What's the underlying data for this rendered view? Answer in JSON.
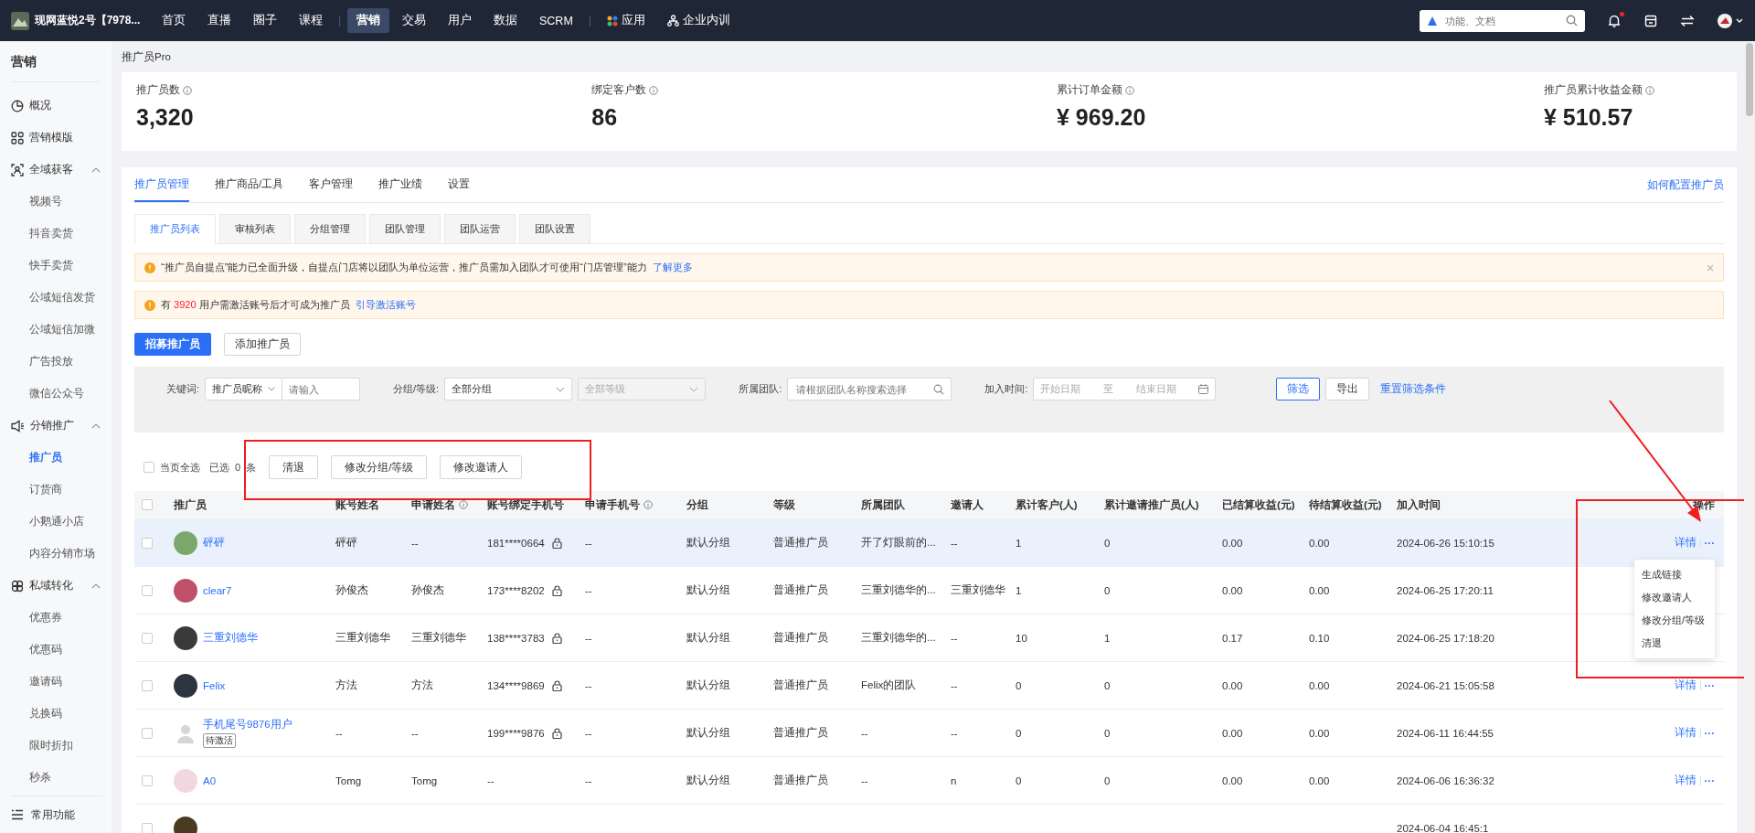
{
  "topnav": {
    "brand": "现网蓝悦2号【7978...",
    "items": [
      {
        "label": "首页",
        "selected": false,
        "kind": "text"
      },
      {
        "label": "直播",
        "selected": false,
        "kind": "text"
      },
      {
        "label": "圈子",
        "selected": false,
        "kind": "text"
      },
      {
        "label": "课程",
        "selected": false,
        "kind": "text"
      },
      {
        "label": "营销",
        "selected": true,
        "kind": "text"
      },
      {
        "label": "交易",
        "selected": false,
        "kind": "text"
      },
      {
        "label": "用户",
        "selected": false,
        "kind": "text"
      },
      {
        "label": "数据",
        "selected": false,
        "kind": "text"
      },
      {
        "label": "SCRM",
        "selected": false,
        "kind": "text"
      },
      {
        "label": "应用",
        "selected": false,
        "kind": "apps"
      },
      {
        "label": "企业内训",
        "selected": false,
        "kind": "org"
      }
    ],
    "search": {
      "placeholder": "功能、文档"
    },
    "notification_dot": true
  },
  "sidebar": {
    "title": "营销",
    "groups": [
      {
        "label": "概况",
        "kind": "pie",
        "expanded": false
      },
      {
        "label": "营销模版",
        "kind": "grid",
        "expanded": false
      },
      {
        "label": "全域获客",
        "kind": "scan",
        "expanded": true,
        "children": [
          {
            "label": "视频号",
            "selected": false
          },
          {
            "label": "抖音卖货",
            "selected": false
          },
          {
            "label": "快手卖货",
            "selected": false
          },
          {
            "label": "公域短信发货",
            "selected": false
          },
          {
            "label": "公域短信加微",
            "selected": false
          },
          {
            "label": "广告投放",
            "selected": false
          },
          {
            "label": "微信公众号",
            "selected": false
          }
        ]
      },
      {
        "label": "分销推广",
        "kind": "speaker",
        "expanded": true,
        "children": [
          {
            "label": "推广员",
            "selected": true
          },
          {
            "label": "订货商",
            "selected": false
          },
          {
            "label": "小鹅通小店",
            "selected": false
          },
          {
            "label": "内容分销市场",
            "selected": false
          }
        ]
      },
      {
        "label": "私域转化",
        "kind": "flower",
        "expanded": true,
        "children": [
          {
            "label": "优惠券",
            "selected": false
          },
          {
            "label": "优惠码",
            "selected": false
          },
          {
            "label": "邀请码",
            "selected": false
          },
          {
            "label": "兑换码",
            "selected": false
          },
          {
            "label": "限时折扣",
            "selected": false
          },
          {
            "label": "秒杀",
            "selected": false
          }
        ]
      }
    ],
    "footer": "常用功能"
  },
  "breadcrumb": "推广员Pro",
  "stats": [
    {
      "label": "推广员数",
      "value": "3,320"
    },
    {
      "label": "绑定客户数",
      "value": "86"
    },
    {
      "label": "累计订单金额",
      "value": "¥ 969.20"
    },
    {
      "label": "推广员累计收益金额",
      "value": "¥ 510.57"
    }
  ],
  "tabs": [
    {
      "label": "推广员管理",
      "selected": true
    },
    {
      "label": "推广商品/工具",
      "selected": false
    },
    {
      "label": "客户管理",
      "selected": false
    },
    {
      "label": "推广业绩",
      "selected": false
    },
    {
      "label": "设置",
      "selected": false
    }
  ],
  "help_link": "如何配置推广员",
  "subtabs": [
    {
      "label": "推广员列表",
      "selected": true
    },
    {
      "label": "审核列表",
      "selected": false
    },
    {
      "label": "分组管理",
      "selected": false
    },
    {
      "label": "团队管理",
      "selected": false
    },
    {
      "label": "团队运营",
      "selected": false
    },
    {
      "label": "团队设置",
      "selected": false
    }
  ],
  "alerts": [
    {
      "text": "“推广员自提点”能力已全面升级，自提点门店将以团队为单位运营，推广员需加入团队才可使用“门店管理”能力",
      "link": "了解更多",
      "closable": true
    },
    {
      "text": "有",
      "count": "3920",
      "suffix": "用户需激活账号后才可成为推广员",
      "link": "引导激活账号"
    }
  ],
  "actions": [
    {
      "label": "招募推广员",
      "kind": "primary"
    },
    {
      "label": "添加推广员",
      "kind": "default"
    }
  ],
  "filters": {
    "keyword_label": "关键词:",
    "keyword_type": "推广员昵称",
    "keyword_placeholder": "请输入",
    "group_label": "分组/等级:",
    "group_value": "全部分组",
    "level_value": "全部等级",
    "level_disabled": true,
    "team_label": "所属团队:",
    "team_placeholder": "请根据团队名称搜索选择",
    "time_label": "加入时间:",
    "start_placeholder": "开始日期",
    "range_sep": "至",
    "end_placeholder": "结束日期",
    "filter_button": "筛选",
    "export_button": "导出",
    "reset_link": "重置筛选条件"
  },
  "batch": {
    "select_all": "当页全选",
    "select_all_checked": false,
    "selected_label": "已选",
    "selected_count": "0",
    "unit": "条",
    "buttons": [
      "清退",
      "修改分组/等级",
      "修改邀请人"
    ]
  },
  "table": {
    "all_checked": false,
    "columns": [
      {
        "label": "推广员"
      },
      {
        "label": "账号姓名"
      },
      {
        "label": "申请姓名",
        "info": true
      },
      {
        "label": "账号绑定手机号"
      },
      {
        "label": "申请手机号",
        "info": true
      },
      {
        "label": "分组"
      },
      {
        "label": "等级"
      },
      {
        "label": "所属团队"
      },
      {
        "label": "邀请人"
      },
      {
        "label": "累计客户(人)"
      },
      {
        "label": "累计邀请推广员(人)"
      },
      {
        "label": "已结算收益(元)"
      },
      {
        "label": "待结算收益(元)"
      },
      {
        "label": "加入时间"
      },
      {
        "label": "操作"
      }
    ],
    "rows": [
      {
        "name": "砰砰",
        "kind": "photo",
        "account_name": "砰砰",
        "apply_name": "--",
        "phone": "181****0664",
        "locked": true,
        "apply_phone": "--",
        "group": "默认分组",
        "level": "普通推广员",
        "team": "开了灯眼前的...",
        "inviter": "--",
        "customers": "1",
        "invited": "0",
        "settled": "0.00",
        "pending_income": "0.00",
        "joined": "2024-06-26 15:10:15",
        "detail": "详情",
        "more": "···",
        "checked": false,
        "highlighted": true
      },
      {
        "name": "clear7",
        "kind": "photo",
        "account_name": "孙俊杰",
        "apply_name": "孙俊杰",
        "phone": "173****8202",
        "locked": true,
        "apply_phone": "--",
        "group": "默认分组",
        "level": "普通推广员",
        "team": "三重刘德华的...",
        "inviter": "三重刘德华",
        "customers": "1",
        "invited": "0",
        "settled": "0.00",
        "pending_income": "0.00",
        "joined": "2024-06-25 17:20:11",
        "checked": false,
        "highlighted": false
      },
      {
        "name": "三重刘德华",
        "kind": "photo",
        "account_name": "三重刘德华",
        "apply_name": "三重刘德华",
        "phone": "138****3783",
        "locked": true,
        "apply_phone": "--",
        "group": "默认分组",
        "level": "普通推广员",
        "team": "三重刘德华的...",
        "inviter": "--",
        "customers": "10",
        "invited": "1",
        "settled": "0.17",
        "pending_income": "0.10",
        "joined": "2024-06-25 17:18:20",
        "checked": false,
        "highlighted": false
      },
      {
        "name": "Felix",
        "kind": "photo",
        "account_name": "方法",
        "apply_name": "方法",
        "phone": "134****9869",
        "locked": true,
        "apply_phone": "--",
        "group": "默认分组",
        "level": "普通推广员",
        "team": "Felix的团队",
        "inviter": "--",
        "customers": "0",
        "invited": "0",
        "settled": "0.00",
        "pending_income": "0.00",
        "joined": "2024-06-21 15:05:58",
        "detail": "详情",
        "more": "···",
        "checked": false,
        "highlighted": false
      },
      {
        "name": "手机尾号9876用户",
        "kind": "default",
        "pending": "待激活",
        "account_name": "--",
        "apply_name": "--",
        "phone": "199****9876",
        "locked": true,
        "apply_phone": "--",
        "group": "默认分组",
        "level": "普通推广员",
        "team": "--",
        "inviter": "--",
        "customers": "0",
        "invited": "0",
        "settled": "0.00",
        "pending_income": "0.00",
        "joined": "2024-06-11 16:44:55",
        "detail": "详情",
        "more": "···",
        "checked": false,
        "highlighted": false
      },
      {
        "name": "A0",
        "kind": "photo",
        "account_name": "Tomg",
        "apply_name": "Tomg",
        "phone": "--",
        "locked": false,
        "apply_phone": "--",
        "group": "默认分组",
        "level": "普通推广员",
        "team": "--",
        "inviter": "n",
        "customers": "0",
        "invited": "0",
        "settled": "0.00",
        "pending_income": "0.00",
        "joined": "2024-06-06 16:36:32",
        "detail": "详情",
        "more": "···",
        "checked": false,
        "highlighted": false
      },
      {
        "kind": "photo",
        "joined": "2024-06-04 16:45:1",
        "checked": false,
        "highlighted": false
      }
    ]
  },
  "row_menu": [
    "生成链接",
    "修改邀请人",
    "修改分组/等级",
    "清退"
  ]
}
